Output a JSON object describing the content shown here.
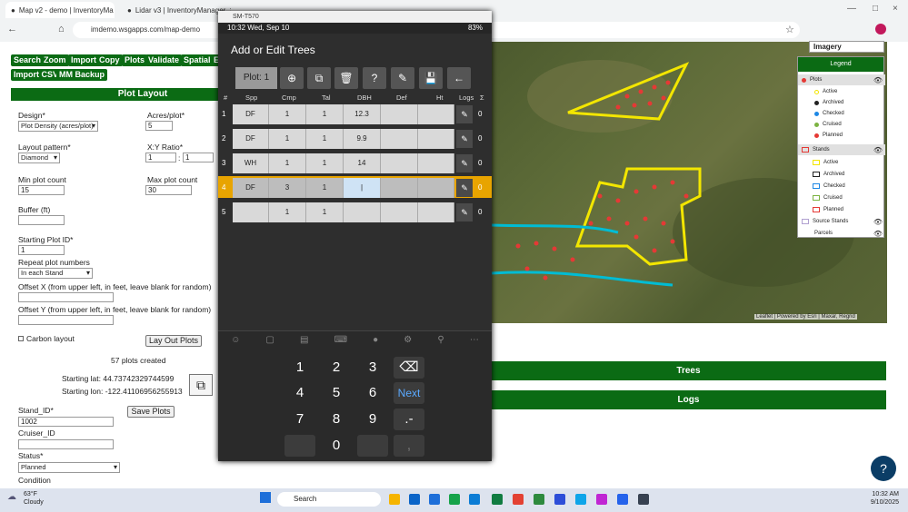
{
  "browser": {
    "tabs": [
      {
        "label": "Map v2 - demo | InventoryMa"
      },
      {
        "label": "Lidar v3 | InventoryManager"
      }
    ],
    "address": "imdemo.wsgapps.com/map-demo"
  },
  "toolbar": {
    "buttons": [
      "Search",
      "Zoom",
      "Import",
      "Copy",
      "Plots",
      "Validate",
      "Spatial",
      "E"
    ],
    "buttons2": [
      "Import CSV",
      "MM Backup"
    ]
  },
  "plot_layout": {
    "title": "Plot Layout",
    "design_label": "Design*",
    "design_value": "Plot Density (acres/plot)",
    "acres_label": "Acres/plot*",
    "acres_value": "5",
    "pattern_label": "Layout pattern*",
    "pattern_value": "Diamond",
    "ratio_label": "X:Y Ratio*",
    "ratio_x": "1",
    "ratio_y": "1",
    "ratio_sep": ":",
    "min_label": "Min plot count",
    "min_value": "15",
    "max_label": "Max plot count",
    "max_value": "30",
    "buffer_label": "Buffer (ft)",
    "start_label": "Starting Plot ID*",
    "start_value": "1",
    "repeat_label": "Repeat plot numbers",
    "repeat_value": "In each Stand",
    "offx_label": "Offset X (from upper left, in feet, leave blank for random)",
    "offy_label": "Offset Y (from upper left, in feet, leave blank for random)",
    "carbon_label": "Carbon layout",
    "layout_btn": "Lay Out Plots",
    "created": "57 plots created",
    "lat": "Starting lat: 44.73742329744599",
    "lon": "Starting lon: -122.41106956255913",
    "stand_label": "Stand_ID*",
    "stand_value": "1002",
    "cruiser_label": "Cruiser_ID",
    "save_btn": "Save Plots",
    "status_label": "Status*",
    "status_value": "Planned",
    "condition_label": "Condition"
  },
  "map": {
    "imagery": "Imagery",
    "legend_title": "Legend",
    "plots_label": "Plots",
    "plot_items": [
      "Active",
      "Archived",
      "Checked",
      "Cruised",
      "Planned"
    ],
    "plot_colors": [
      "#f3e600",
      "#222222",
      "#1e88e5",
      "#7cb342",
      "#e53935"
    ],
    "stands_label": "Stands",
    "stand_items": [
      "Active",
      "Archived",
      "Checked",
      "Cruised",
      "Planned"
    ],
    "stand_colors": [
      "#f3e600",
      "#222222",
      "#1e88e5",
      "#7cb342",
      "#e53935"
    ],
    "source_stands": "Source Stands",
    "parcels": "Parcels",
    "attribution": "Leaflet | Powered by Esri | Maxar, Regrid",
    "trees_btn": "Trees",
    "logs_btn": "Logs"
  },
  "dialog": {
    "device": "SM-T570",
    "time": "10:32 Wed, Sep 10",
    "battery": "83%",
    "title": "Add or Edit Trees",
    "plot": "Plot: 1",
    "columns": [
      "#",
      "Spp",
      "Cmp",
      "Tal",
      "DBH",
      "Def",
      "Ht",
      "Logs",
      "Σ"
    ],
    "rows": [
      {
        "n": "1",
        "spp": "DF",
        "cmp": "1",
        "tal": "1",
        "dbh": "12.3",
        "def": "",
        "ht": "",
        "sum": "0"
      },
      {
        "n": "2",
        "spp": "DF",
        "cmp": "1",
        "tal": "1",
        "dbh": "9.9",
        "def": "",
        "ht": "",
        "sum": "0"
      },
      {
        "n": "3",
        "spp": "WH",
        "cmp": "1",
        "tal": "1",
        "dbh": "14",
        "def": "",
        "ht": "",
        "sum": "0"
      },
      {
        "n": "4",
        "spp": "DF",
        "cmp": "3",
        "tal": "1",
        "dbh": "|",
        "def": "",
        "ht": "",
        "sum": "0"
      },
      {
        "n": "5",
        "spp": "",
        "cmp": "1",
        "tal": "1",
        "dbh": "",
        "def": "",
        "ht": "",
        "sum": "0"
      }
    ],
    "keys": [
      "1",
      "2",
      "3",
      "⌫",
      "4",
      "5",
      "6",
      "Next",
      "7",
      "8",
      "9",
      ".-",
      "",
      "0",
      "",
      ","
    ]
  },
  "taskbar": {
    "weather_temp": "63°F",
    "weather_desc": "Cloudy",
    "search": "Search",
    "time": "10:32 AM",
    "date": "9/10/2025"
  }
}
